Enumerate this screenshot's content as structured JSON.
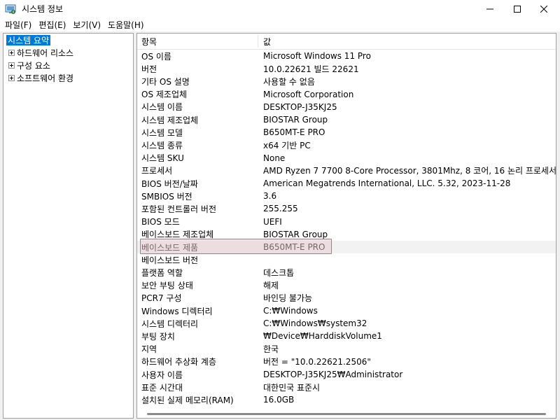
{
  "window": {
    "title": "시스템 정보"
  },
  "menu": [
    "파일(F)",
    "편집(E)",
    "보기(V)",
    "도움말(H)"
  ],
  "tree": {
    "root": "시스템 요약",
    "children": [
      "하드웨어 리소스",
      "구성 요소",
      "소프트웨어 환경"
    ]
  },
  "list": {
    "headers": {
      "item": "항목",
      "value": "값"
    },
    "rows": [
      {
        "k": "OS 이름",
        "v": "Microsoft Windows 11 Pro"
      },
      {
        "k": "버전",
        "v": "10.0.22621 빌드 22621"
      },
      {
        "k": "기타 OS 설명",
        "v": "사용할 수 없음"
      },
      {
        "k": "OS 제조업체",
        "v": "Microsoft Corporation"
      },
      {
        "k": "시스템 이름",
        "v": "DESKTOP-J35KJ25"
      },
      {
        "k": "시스템 제조업체",
        "v": "BIOSTAR Group"
      },
      {
        "k": "시스템 모델",
        "v": "B650MT-E PRO"
      },
      {
        "k": "시스템 종류",
        "v": "x64 기반 PC"
      },
      {
        "k": "시스템 SKU",
        "v": "None"
      },
      {
        "k": "프로세서",
        "v": "AMD Ryzen 7 7700 8-Core Processor, 3801Mhz, 8 코어, 16 논리 프로세서"
      },
      {
        "k": "BIOS 버전/날짜",
        "v": "American Megatrends International, LLC. 5.32, 2023-11-28"
      },
      {
        "k": "SMBIOS 버전",
        "v": "3.6"
      },
      {
        "k": "포함된 컨트롤러 버전",
        "v": "255.255"
      },
      {
        "k": "BIOS 모드",
        "v": "UEFI"
      },
      {
        "k": "베이스보드 제조업체",
        "v": "BIOSTAR Group"
      },
      {
        "k": "베이스보드 제품",
        "v": "B650MT-E PRO"
      },
      {
        "k": "베이스보드 버전",
        "v": ""
      },
      {
        "k": "플랫폼 역할",
        "v": "데스크톱"
      },
      {
        "k": "보안 부팅 상태",
        "v": "해제"
      },
      {
        "k": "PCR7 구성",
        "v": "바인딩 불가능"
      },
      {
        "k": "Windows 디렉터리",
        "v": "C:₩Windows"
      },
      {
        "k": "시스템 디렉터리",
        "v": "C:₩Windows₩system32"
      },
      {
        "k": "부팅 장치",
        "v": "₩Device₩HarddiskVolume1"
      },
      {
        "k": "지역",
        "v": "한국"
      },
      {
        "k": "하드웨어 추상화 계층",
        "v": "버전 = \"10.0.22621.2506\""
      },
      {
        "k": "사용자 이름",
        "v": "DESKTOP-J35KJ25₩Administrator"
      },
      {
        "k": "표준 시간대",
        "v": "대한민국 표준시"
      },
      {
        "k": "설치된 실제 메모리(RAM)",
        "v": "16.0GB"
      }
    ]
  },
  "colors": {
    "selection": "#0078d7",
    "highlight": "#e8c8ce"
  }
}
